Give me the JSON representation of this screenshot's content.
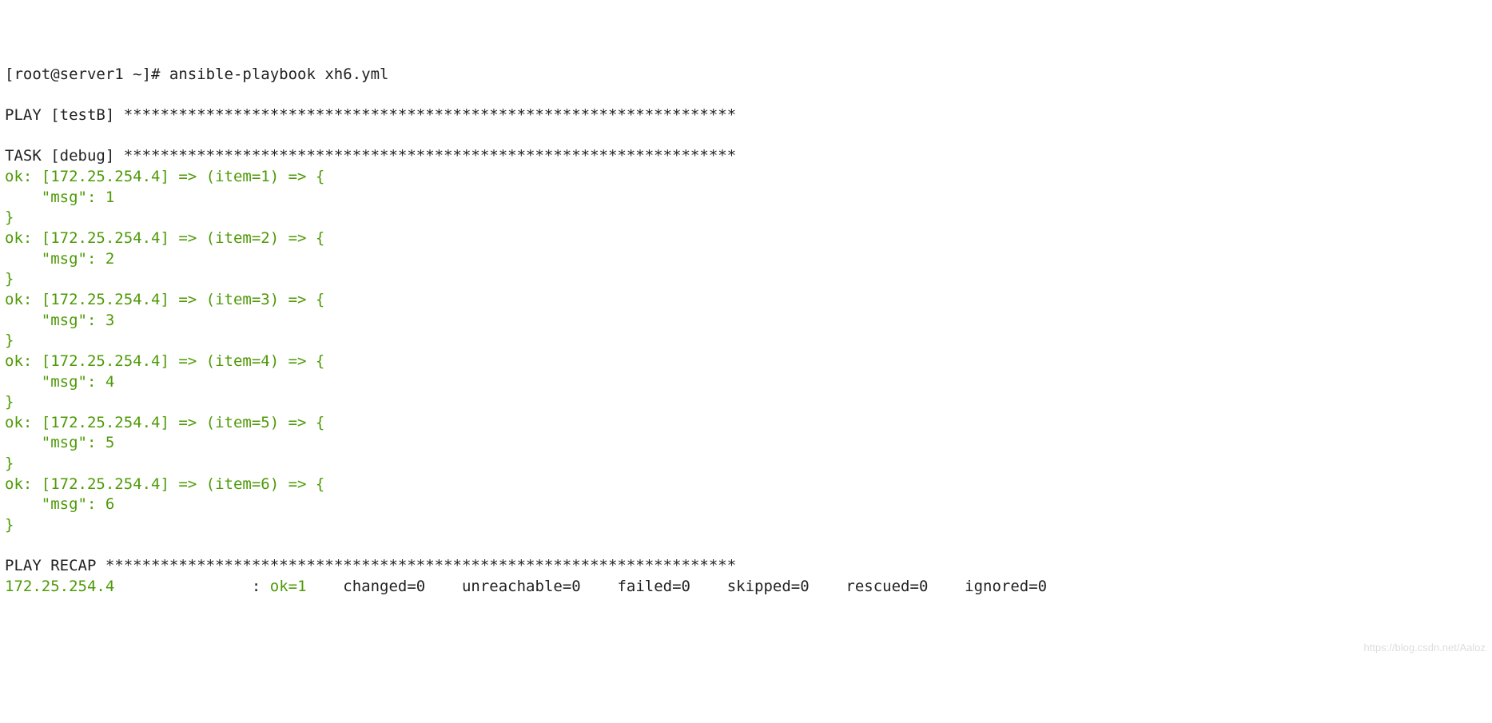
{
  "prompt": {
    "user": "root",
    "host": "server1",
    "cwd": "~",
    "symbol": "#",
    "command": "ansible-playbook xh6.yml"
  },
  "play": {
    "label": "PLAY",
    "name": "testB",
    "stars": "*******************************************************************"
  },
  "task": {
    "label": "TASK",
    "name": "debug",
    "stars": "*******************************************************************"
  },
  "items": [
    {
      "host": "172.25.254.4",
      "item": "1",
      "msg": "1"
    },
    {
      "host": "172.25.254.4",
      "item": "2",
      "msg": "2"
    },
    {
      "host": "172.25.254.4",
      "item": "3",
      "msg": "3"
    },
    {
      "host": "172.25.254.4",
      "item": "4",
      "msg": "4"
    },
    {
      "host": "172.25.254.4",
      "item": "5",
      "msg": "5"
    },
    {
      "host": "172.25.254.4",
      "item": "6",
      "msg": "6"
    }
  ],
  "recap": {
    "label": "PLAY RECAP",
    "stars": "*********************************************************************",
    "host": "172.25.254.4",
    "ok_label": "ok",
    "ok": "1",
    "changed_label": "changed",
    "changed": "0",
    "unreachable_label": "unreachable",
    "unreachable": "0",
    "failed_label": "failed",
    "failed": "0",
    "skipped_label": "skipped",
    "skipped": "0",
    "rescued_label": "rescued",
    "rescued": "0",
    "ignored_label": "ignored",
    "ignored": "0"
  },
  "watermark": "https://blog.csdn.net/Aaloz"
}
